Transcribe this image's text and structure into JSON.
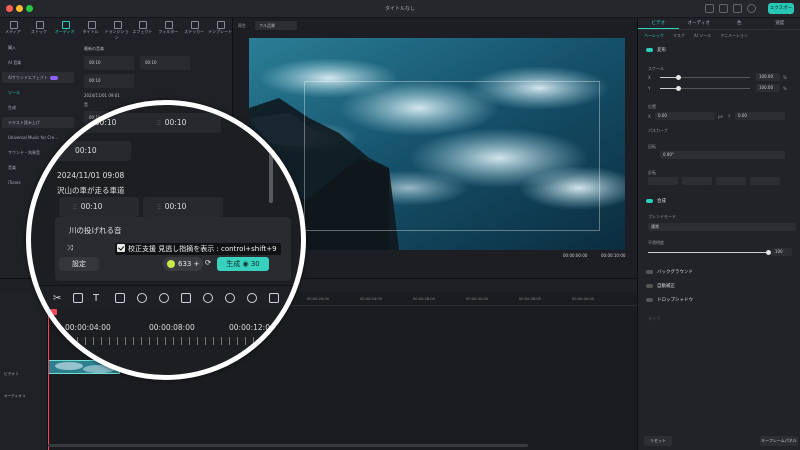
{
  "window": {
    "title": "タイトルなし",
    "export_label": "エクスポート"
  },
  "media": {
    "tabs": [
      {
        "label": "メディア",
        "active": false
      },
      {
        "label": "ストック",
        "active": false
      },
      {
        "label": "オーディオ",
        "active": true
      },
      {
        "label": "タイトル",
        "active": false
      },
      {
        "label": "トランジション",
        "active": false
      },
      {
        "label": "エフェクト",
        "active": false
      },
      {
        "label": "フィルター",
        "active": false
      },
      {
        "label": "ステッカー",
        "active": false
      },
      {
        "label": "テンプレート",
        "active": false
      }
    ],
    "sidebar": [
      {
        "label": "購入",
        "active": false
      },
      {
        "label": "AI 音楽",
        "active": false
      },
      {
        "label": "AIサウンドエフェクト",
        "active": false
      },
      {
        "label": "ツール",
        "active": true
      },
      {
        "label": "生成",
        "active": false
      },
      {
        "label": "テキスト読み上げ",
        "active": false
      },
      {
        "label": "Universal Music for Cre...",
        "active": false
      },
      {
        "label": "サウンド・効果音",
        "active": false
      },
      {
        "label": "音楽",
        "active": false
      },
      {
        "label": "iTunes",
        "active": false
      }
    ],
    "recent_label": "最新の音楽",
    "date_label": "2024/11/01 09:01",
    "section_label": "音",
    "durations": [
      "00:10",
      "00:10",
      "00:10",
      "00:10"
    ]
  },
  "preview": {
    "label": "再生",
    "quality": "フル品質",
    "time_current": "00:00:00:00",
    "time_total": "00:00:10:00"
  },
  "inspector": {
    "tabs": [
      {
        "label": "ビデオ",
        "active": true
      },
      {
        "label": "オーディオ",
        "active": false
      },
      {
        "label": "色",
        "active": false
      },
      {
        "label": "速度",
        "active": false
      }
    ],
    "subtabs": [
      {
        "label": "ベーシック",
        "active": true
      },
      {
        "label": "マスク",
        "active": false
      },
      {
        "label": "AI ツール",
        "active": false
      },
      {
        "label": "アニメーション",
        "active": false
      }
    ],
    "transform_label": "変形",
    "scale_label": "スケール",
    "x_label": "X",
    "y_label": "Y",
    "scale_x": "100.00",
    "scale_y": "100.00",
    "scale_x_level": 0.2,
    "scale_y_level": 0.2,
    "percent": "%",
    "position_label": "位置",
    "pos_x": "0.00",
    "pos_y": "0.00",
    "px_unit": "px",
    "path_curve_label": "パスカーブ",
    "rotate_label": "回転",
    "rotate_value": "0.00°",
    "flip_label": "反転",
    "composite_label": "合成",
    "blend_label": "ブレンドモード",
    "blend_value": "通常",
    "opacity_label": "不透明度",
    "opacity_value": "100",
    "opacity_level": 1.0,
    "background_label": "バックグラウンド",
    "auto_correct_label": "自動補正",
    "drop_shadow_label": "ドロップシャドウ",
    "type_label": "タイプ",
    "reset_label": "リセット",
    "keyframe_label": "キーフレームパネル"
  },
  "timeline": {
    "ruler": [
      "00:00:00:00",
      "00:00:04:00",
      "00:00:08:00",
      "00:00:12:00",
      "00:00:16:00",
      "00:00:20:00",
      "00:00:24:00",
      "00:00:28:00",
      "00:00:32:00",
      "00:00:36:00",
      "00:00:40:00"
    ],
    "track_video": "ビデオ 1",
    "track_audio": "オーディオ 1"
  },
  "lens": {
    "card_durations": [
      "00:10",
      "00:10",
      "00:10",
      "00:10"
    ],
    "date": "2024/11/01 09:08",
    "item_title": "沢山の車が走る車道",
    "prompt_title": "川の投げれる音",
    "tooltip": "校正支援 見逃し指摘を表示 : control+shift+9",
    "setting_label": "設定",
    "credits": "633",
    "generate_label": "生成",
    "generate_cost": "30",
    "ruler": [
      "00:00:04:00",
      "00:00:08:00",
      "00:00:12:00"
    ]
  }
}
